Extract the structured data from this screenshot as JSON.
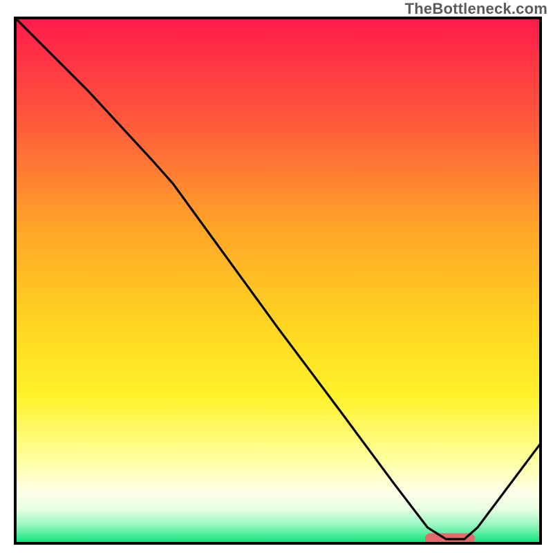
{
  "watermark": "TheBottleneck.com",
  "chart_data": {
    "type": "line",
    "title": "",
    "xlabel": "",
    "ylabel": "",
    "xlim": [
      0,
      100
    ],
    "ylim": [
      0,
      100
    ],
    "grid": false,
    "legend": false,
    "background_gradient": {
      "stops": [
        {
          "offset": 0.0,
          "color": "#ff1a4b"
        },
        {
          "offset": 0.2,
          "color": "#ff5a3b"
        },
        {
          "offset": 0.4,
          "color": "#ffa528"
        },
        {
          "offset": 0.58,
          "color": "#ffd421"
        },
        {
          "offset": 0.72,
          "color": "#fff22a"
        },
        {
          "offset": 0.84,
          "color": "#ffff9e"
        },
        {
          "offset": 0.9,
          "color": "#ffffe6"
        },
        {
          "offset": 0.935,
          "color": "#e9ffe5"
        },
        {
          "offset": 0.965,
          "color": "#97f7bf"
        },
        {
          "offset": 1.0,
          "color": "#09e27a"
        }
      ]
    },
    "series": [
      {
        "name": "bottleneck-curve",
        "color": "#000000",
        "x": [
          0.0,
          14.0,
          26.0,
          30.0,
          38.0,
          50.0,
          62.0,
          72.0,
          78.5,
          82.0,
          85.5,
          88.0,
          100.0
        ],
        "y": [
          100.0,
          86.0,
          73.0,
          68.5,
          57.5,
          41.0,
          25.0,
          11.5,
          3.0,
          0.8,
          0.8,
          3.0,
          19.0
        ]
      }
    ],
    "marker": {
      "name": "optimal-range-bar",
      "color": "#e26a6a",
      "x_start": 78.0,
      "x_end": 87.5,
      "y": 0.9,
      "thickness": 2.0
    },
    "frame": {
      "stroke": "#000000",
      "stroke_width": 4
    }
  }
}
